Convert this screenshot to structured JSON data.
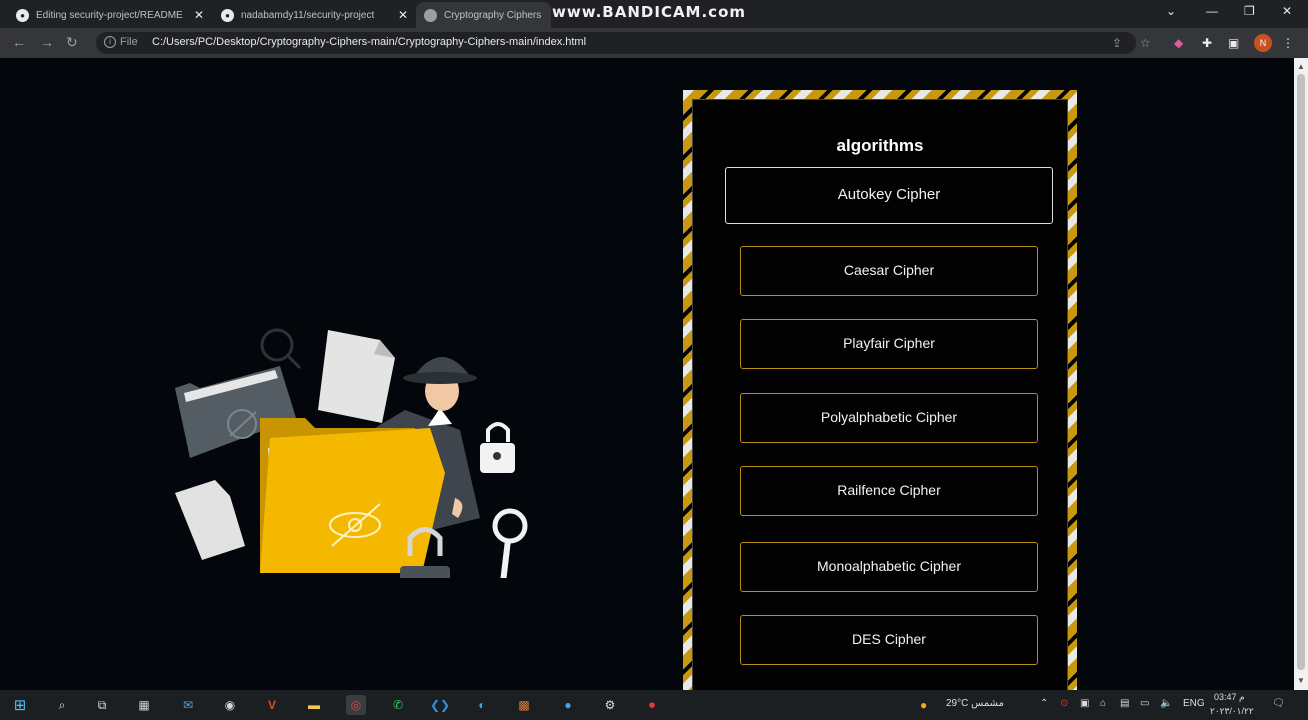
{
  "browser": {
    "tabs": [
      {
        "title": "Editing security-project/README"
      },
      {
        "title": "nadabamdy11/security-project"
      },
      {
        "title": "Cryptography Ciphers"
      }
    ],
    "watermark": "www.BANDICAM.com",
    "address": {
      "scheme": "File",
      "url": "C:/Users/PC/Desktop/Cryptography-Ciphers-main/Cryptography-Ciphers-main/index.html"
    },
    "profile_initial": "N"
  },
  "page": {
    "panel_title": "algorithms",
    "algorithms": [
      {
        "label": "Autokey Cipher"
      },
      {
        "label": "Caesar Cipher"
      },
      {
        "label": "Playfair Cipher"
      },
      {
        "label": "Polyalphabetic Cipher"
      },
      {
        "label": "Railfence Cipher"
      },
      {
        "label": "Monoalphabetic Cipher"
      },
      {
        "label": "DES Cipher"
      }
    ]
  },
  "taskbar": {
    "weather": "29°C مشمس",
    "language": "ENG",
    "time": "03:47 م",
    "date": "٢٠٢٣/٠١/٢٢"
  },
  "colors": {
    "accent_gold": "#c79810",
    "background": "#03060a",
    "folder_yellow": "#f5b800"
  }
}
